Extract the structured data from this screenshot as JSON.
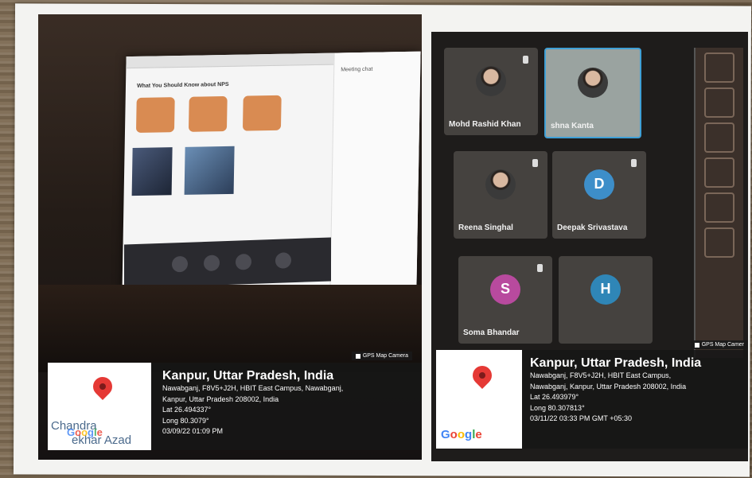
{
  "left_photo": {
    "camera_badge": "GPS Map Camera",
    "title": "Kanpur, Uttar Pradesh, India",
    "address_line1": "Nawabganj, F8V5+J2H, HBIT East Campus, Nawabganj,",
    "address_line2": "Kanpur, Uttar Pradesh 208002, India",
    "lat": "Lat 26.494337°",
    "long": "Long 80.3079°",
    "datetime": "03/09/22 01:09 PM",
    "watermark": [
      "Chandra",
      "ekhar Azad"
    ],
    "screen": {
      "slide_title": "What You Should Know about NPS",
      "chat_title": "Meeting chat"
    }
  },
  "right_photo": {
    "camera_badge": "GPS Map Camer",
    "title": "Kanpur, Uttar Pradesh, India",
    "address_line1": "Nawabganj, F8V5+J2H, HBIT East Campus,",
    "address_line2": "Nawabganj, Kanpur, Uttar Pradesh 208002, India",
    "lat": "Lat 26.493979°",
    "long": "Long 80.307813°",
    "datetime": "03/11/22 03:33 PM GMT +05:30",
    "participants": [
      {
        "name": "Mohd Rashid Khan",
        "initial": "",
        "color": "#2f2c2a"
      },
      {
        "name": "shna Kanta",
        "initial": "",
        "color": "#9aa3a0"
      },
      {
        "name": "Reena Singhal",
        "initial": "",
        "color": "#4a4643"
      },
      {
        "name": "Deepak Srivastava",
        "initial": "D",
        "color": "#3d8ec9"
      },
      {
        "name": "Soma Bhandar",
        "initial": "S",
        "color": "#b84a9e"
      },
      {
        "name": "",
        "initial": "H",
        "color": "#2f86b7"
      }
    ]
  },
  "google_logo": "Google"
}
